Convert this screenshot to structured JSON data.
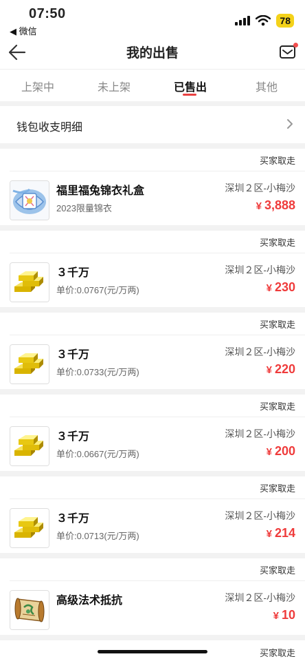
{
  "status_bar": {
    "time": "07:50",
    "back_app": "◀ 微信",
    "battery": "78"
  },
  "header": {
    "title": "我的出售"
  },
  "tabs": [
    {
      "label": "上架中",
      "active": false
    },
    {
      "label": "未上架",
      "active": false
    },
    {
      "label": "已售出",
      "active": true
    },
    {
      "label": "其他",
      "active": false
    }
  ],
  "wallet": {
    "label": "钱包收支明细"
  },
  "orders": [
    {
      "status": "买家取走",
      "name": "福里福兔锦衣礼盒",
      "sub": "2023限量锦衣",
      "server": "深圳２区-小梅沙",
      "currency": "¥",
      "price": "3,888",
      "icon": "gift-box-icon"
    },
    {
      "status": "买家取走",
      "name": "３千万",
      "sub": "单价:0.0767(元/万两)",
      "server": "深圳２区-小梅沙",
      "currency": "¥",
      "price": "230",
      "icon": "gold-bars-icon"
    },
    {
      "status": "买家取走",
      "name": "３千万",
      "sub": "单价:0.0733(元/万两)",
      "server": "深圳２区-小梅沙",
      "currency": "¥",
      "price": "220",
      "icon": "gold-bars-icon"
    },
    {
      "status": "买家取走",
      "name": "３千万",
      "sub": "单价:0.0667(元/万两)",
      "server": "深圳２区-小梅沙",
      "currency": "¥",
      "price": "200",
      "icon": "gold-bars-icon"
    },
    {
      "status": "买家取走",
      "name": "３千万",
      "sub": "单价:0.0713(元/万两)",
      "server": "深圳２区-小梅沙",
      "currency": "¥",
      "price": "214",
      "icon": "gold-bars-icon"
    },
    {
      "status": "买家取走",
      "name": "高级法术抵抗",
      "sub": "",
      "server": "深圳２区-小梅沙",
      "currency": "¥",
      "price": "10",
      "icon": "scroll-icon"
    }
  ],
  "partial_order": {
    "status": "买家取走"
  },
  "colors": {
    "accent": "#ef3b3b",
    "battery": "#f4d21a"
  }
}
